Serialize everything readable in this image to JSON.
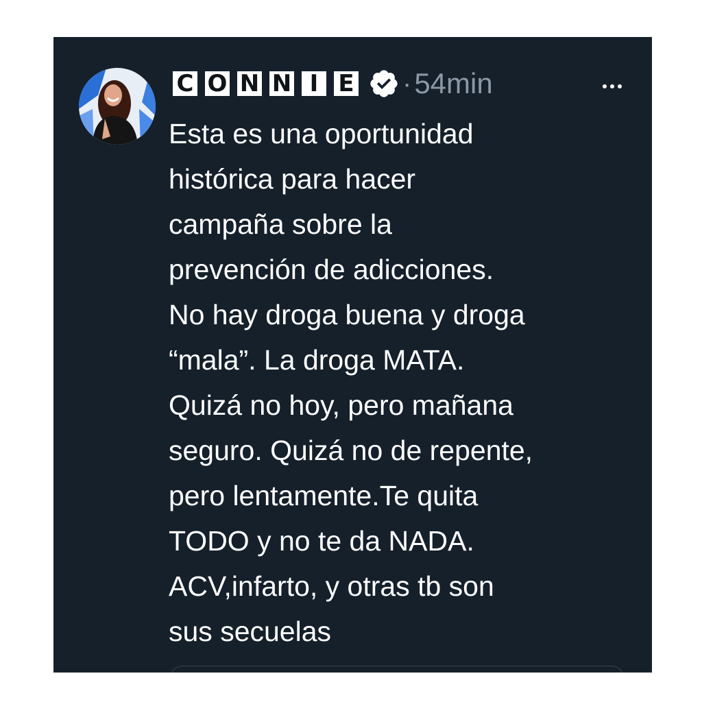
{
  "tweet": {
    "display_name_letters": [
      "C",
      "O",
      "N",
      "N",
      "I",
      "E"
    ],
    "separator": "·",
    "timestamp": "54min",
    "verified": true,
    "body": "Esta es una oportunidad\nhistórica para hacer\ncampaña sobre la\nprevención de adicciones.\nNo hay droga buena y droga\n“mala”. La droga MATA.\nQuizá no hoy, pero mañana\nseguro. Quizá no de repente,\npero lentamente.Te quita\nTODO y no te da NADA.\nACV,infarto, y otras tb son\nsus secuelas"
  },
  "icons": {
    "verified": "verified-badge-icon",
    "more": "more-options-icon"
  },
  "colors": {
    "background": "#15202b",
    "text": "#ffffff",
    "muted": "#8b98a5"
  }
}
